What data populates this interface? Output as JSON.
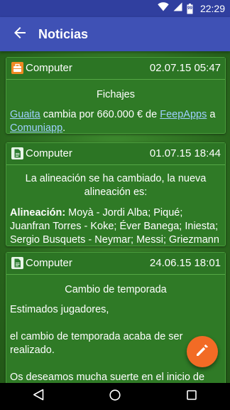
{
  "status_bar": {
    "time": "22:29",
    "battery_level": "99"
  },
  "toolbar": {
    "title": "Noticias"
  },
  "cards": [
    {
      "author": "Computer",
      "date": "02.07.15 05:47",
      "icon": "briefcase-icon",
      "title": "Fichajes",
      "body": {
        "link1": "Guaita",
        "text1": " cambia por 660.000 € de ",
        "link2": "FeepApps",
        "text2": " a ",
        "link3": "Comuniapp",
        "text3": "."
      }
    },
    {
      "author": "Computer",
      "date": "01.07.15 18:44",
      "icon": "document-icon",
      "title": "La alineación se ha cambiado, la nueva alineación es:",
      "body": {
        "label": "Alineación:",
        "text": " Moyà - Jordi Alba; Piqué; Juanfran Torres - Koke; Éver Banega; Iniesta; Sergio Busquets - Neymar; Messi; Griezmann"
      }
    },
    {
      "author": "Computer",
      "date": "24.06.15 18:01",
      "icon": "document-icon",
      "title": "Cambio de temporada",
      "body": {
        "p1": "Estimados jugadores,",
        "p2": "el cambio de temporada acaba de ser realizado.",
        "p3": "Os deseamos mucha suerte en el inicio de una nueva temporada!"
      }
    }
  ],
  "colors": {
    "status_bar": "#303f9f",
    "toolbar": "#3f51b5",
    "fab": "#f26b25",
    "card": "#2f7a26",
    "link": "#9fd0ff"
  }
}
